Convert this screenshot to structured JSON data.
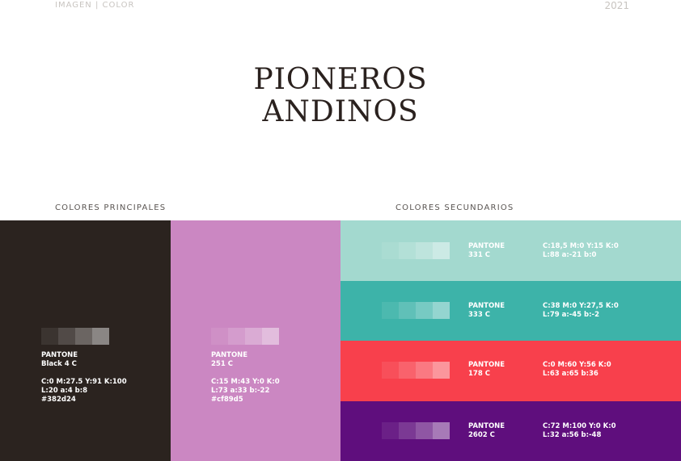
{
  "header": {
    "section": "IMAGEN | COLOR",
    "year": "2021"
  },
  "logo": {
    "line1": "PIONEROS",
    "line2": "ANDINOS"
  },
  "sections": {
    "principal": "COLORES PRINCIPALES",
    "secondary": "COLORES SECUNDARIOS"
  },
  "colors": {
    "black": {
      "fill": "#2b231f",
      "pantone": "PANTONE",
      "code": "Black 4 C",
      "cmyk": "C:0  M:27.5  Y:91  K:100",
      "lab": "L:20  a:4  b:8",
      "hex": "#382d24"
    },
    "pink": {
      "fill": "#cb87c2",
      "pantone": "PANTONE",
      "code": "251 C",
      "cmyk": "C:15  M:43  Y:0  K:0",
      "lab": "L:73  a:33  b:-22",
      "hex": "#cf89d5"
    },
    "mint": {
      "fill": "#a3d9cf",
      "pantone": "PANTONE",
      "code": "331 C",
      "cmyk": "C:18,5  M:0  Y:15  K:0",
      "lab": "L:88  a:-21  b:0"
    },
    "teal": {
      "fill": "#3db3a9",
      "pantone": "PANTONE",
      "code": "333 C",
      "cmyk": "C:38  M:0  Y:27,5  K:0",
      "lab": "L:79  a:-45  b:-2"
    },
    "red": {
      "fill": "#f8404c",
      "pantone": "PANTONE",
      "code": "178 C",
      "cmyk": "C:0  M:60  Y:56  K:0",
      "lab": "L:63  a:65  b:36"
    },
    "purple": {
      "fill": "#5f0e7d",
      "pantone": "PANTONE",
      "code": "2602 C",
      "cmyk": "C:72  M:100  Y:0  K:0",
      "lab": "L:32  a:56  b:-48"
    }
  }
}
